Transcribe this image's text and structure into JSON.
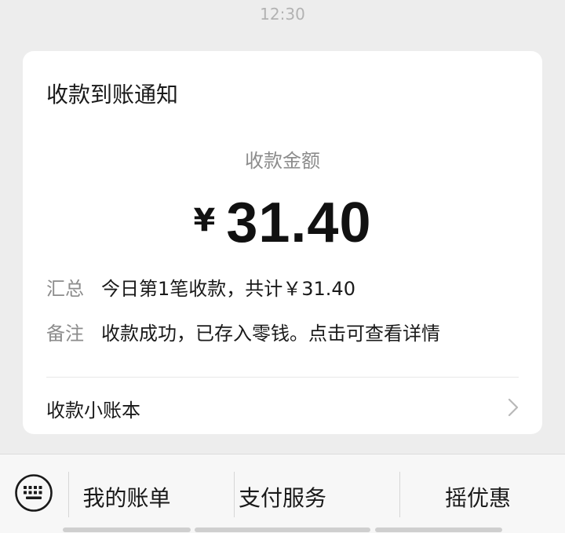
{
  "status": {
    "time": "12:30"
  },
  "card": {
    "title": "收款到账通知",
    "amount_label": "收款金额",
    "currency_symbol": "¥",
    "amount_value": "31.40",
    "summary": {
      "key": "汇总",
      "value": "今日第1笔收款，共计￥31.40"
    },
    "remark": {
      "key": "备注",
      "value": "收款成功，已存入零钱。点击可查看详情"
    },
    "ledger_label": "收款小账本"
  },
  "bottom_menu": {
    "items": [
      {
        "label": "我的账单"
      },
      {
        "label": "支付服务"
      },
      {
        "label": "摇优惠"
      }
    ]
  }
}
